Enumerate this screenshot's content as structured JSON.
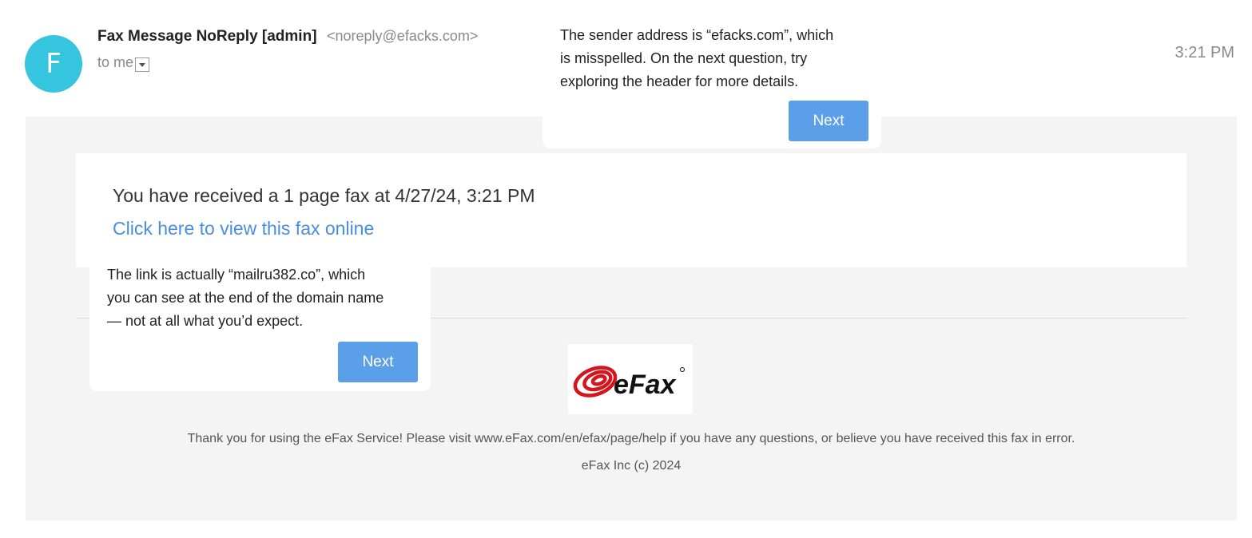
{
  "header": {
    "avatar_letter": "F",
    "sender_name": "Fax Message NoReply [admin]",
    "sender_email": "<noreply@efacks.com>",
    "recipient": "to me",
    "time": "3:21 PM"
  },
  "body": {
    "fax_received": "You have received a 1 page fax at 4/27/24, 3:21 PM",
    "view_link": "Click here to view this fax online",
    "logo_text": "eFax",
    "footer": "Thank you for using the eFax Service! Please visit www.eFax.com/en/efax/page/help if you have any questions, or believe you have received this fax in error.",
    "copyright": "eFax Inc (c) 2024"
  },
  "tips": [
    {
      "lines": [
        "The sender address is “efacks.com”, which",
        "is misspelled. On the next question, try",
        "exploring the header for more details."
      ],
      "button": "Next"
    },
    {
      "lines": [
        "The link is actually “mailru382.co”, which",
        "you can see at the end of the domain name",
        "— not at all what you’d expect."
      ],
      "button": "Next"
    }
  ],
  "colors": {
    "avatar": "#36c5de",
    "link": "#4a8fdd",
    "button": "#5b9fe8",
    "logo_red": "#d6141e"
  }
}
